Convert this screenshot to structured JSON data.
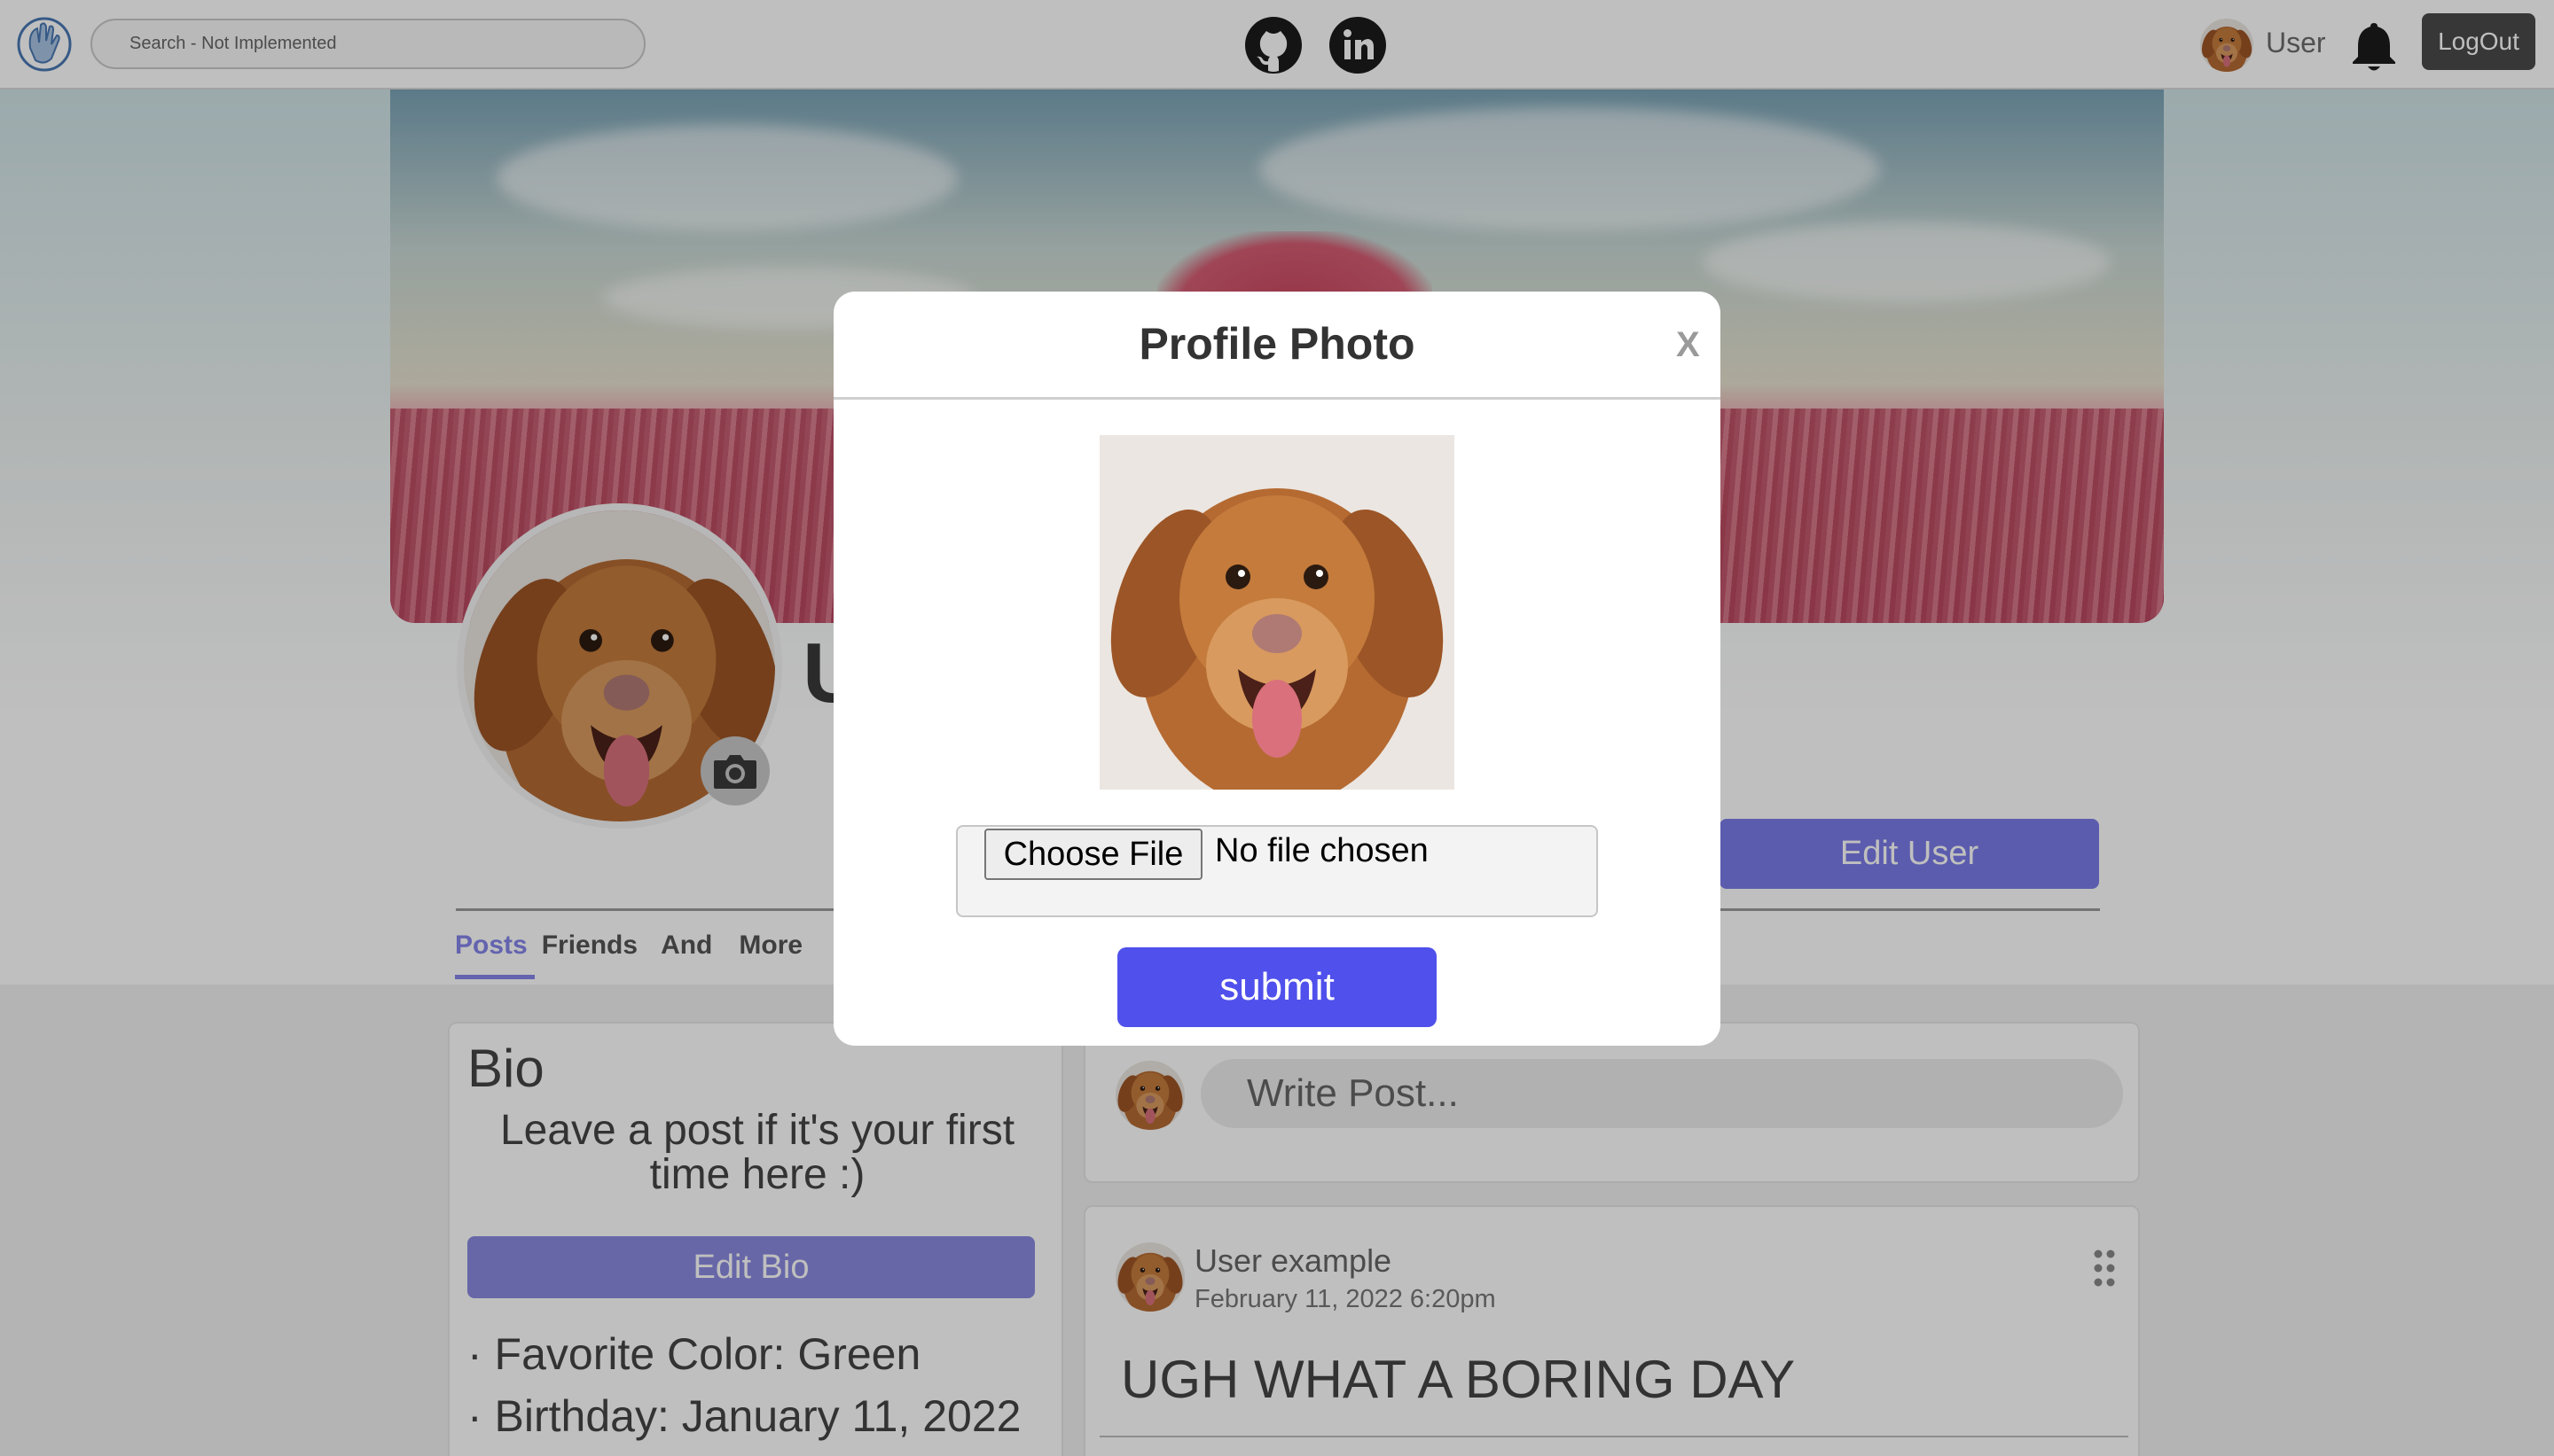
{
  "nav": {
    "search_placeholder": "Search - Not Implemented",
    "user_label": "User",
    "logout_label": "LogOut",
    "icons": [
      "hand-logo-icon",
      "github-icon",
      "linkedin-icon",
      "bell-icon"
    ]
  },
  "profile": {
    "name_initial": "U",
    "edit_user_label": "Edit User",
    "tabs": [
      "Posts",
      "Friends",
      "And",
      "More"
    ],
    "active_tab": "Posts"
  },
  "bio": {
    "title": "Bio",
    "text": "Leave a post if it's your first time here :)",
    "edit_label": "Edit Bio",
    "facts": [
      "· Favorite Color: Green",
      "· Birthday: January 11, 2022"
    ]
  },
  "composer": {
    "placeholder": "Write Post..."
  },
  "post": {
    "author": "User example",
    "date": "February 11, 2022 6:20pm",
    "body": "UGH WHAT A BORING DAY"
  },
  "modal": {
    "title": "Profile Photo",
    "close_label": "X",
    "choose_file_label": "Choose File",
    "file_status": "No file chosen",
    "submit_label": "submit"
  },
  "colors": {
    "accent": "#5050ec",
    "accent_muted": "#7b7be8",
    "dark_button": "#4a4a4a"
  }
}
